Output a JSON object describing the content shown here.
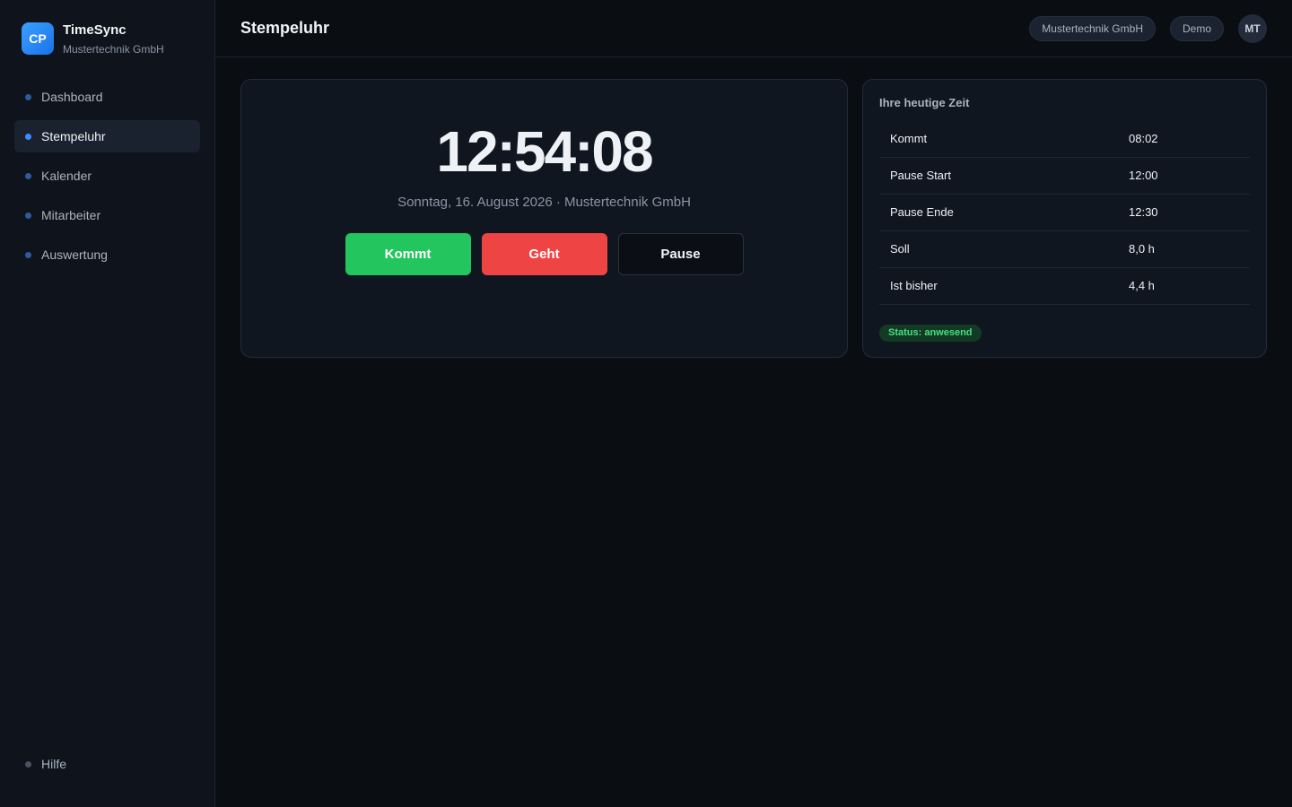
{
  "brand": {
    "logo": "CP",
    "name": "TimeSync",
    "company": "Mustertechnik GmbH"
  },
  "sidebar": {
    "items": [
      {
        "label": "Dashboard",
        "active": false
      },
      {
        "label": "Stempeluhr",
        "active": true
      },
      {
        "label": "Kalender",
        "active": false
      },
      {
        "label": "Mitarbeiter",
        "active": false
      },
      {
        "label": "Auswertung",
        "active": false
      }
    ],
    "help_label": "Hilfe"
  },
  "header": {
    "title": "Stempeluhr",
    "company_pill": "Mustertechnik GmbH",
    "mode_pill": "Demo",
    "avatar_initials": "MT"
  },
  "clock": {
    "time": "12:54:08",
    "date_line": "Sonntag, 16. August 2026 · Mustertechnik GmbH",
    "buttons": {
      "kommt": "Kommt",
      "geht": "Geht",
      "pause": "Pause"
    }
  },
  "today": {
    "title": "Ihre heutige Zeit",
    "rows": [
      {
        "label": "Kommt",
        "value": "08:02"
      },
      {
        "label": "Pause Start",
        "value": "12:00"
      },
      {
        "label": "Pause Ende",
        "value": "12:30"
      },
      {
        "label": "Soll",
        "value": "8,0 h"
      },
      {
        "label": "Ist bisher",
        "value": "4,4 h"
      }
    ],
    "status": "Status: anwesend"
  },
  "colors": {
    "accent": "#3b8cff",
    "kommt": "#22c55e",
    "geht": "#ef4444",
    "status_ok": "#4ade80"
  }
}
